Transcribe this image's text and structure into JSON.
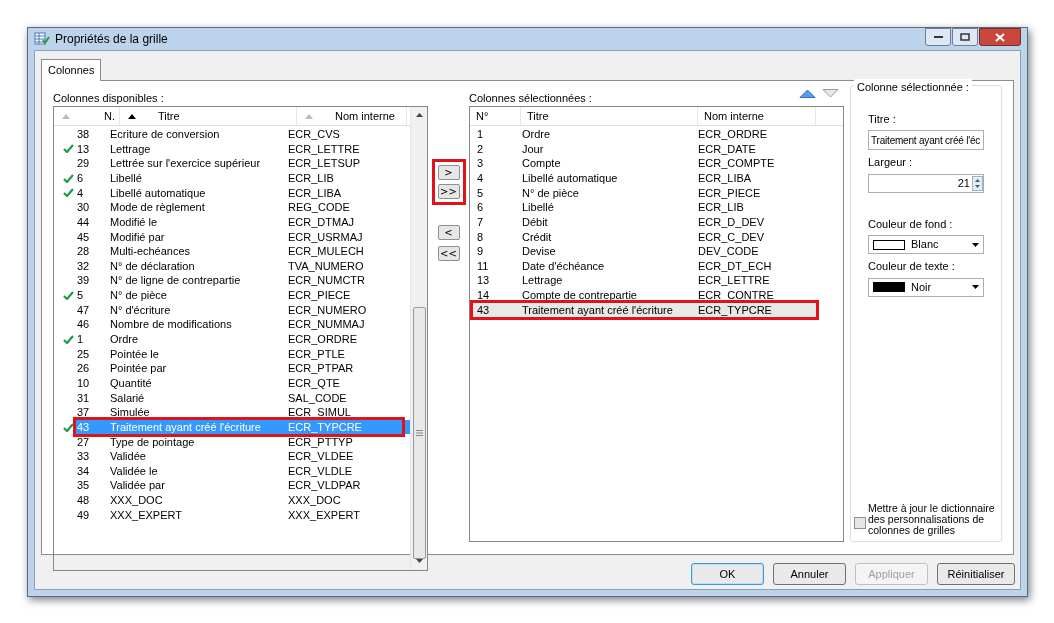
{
  "window": {
    "title": "Propriétés de la grille"
  },
  "tabs": [
    {
      "label": "Colonnes",
      "selected": true
    }
  ],
  "available": {
    "label": "Colonnes disponibles :",
    "columns": [
      {
        "label": "N.",
        "sorted": false
      },
      {
        "label": "Titre",
        "sorted": true
      },
      {
        "label": "Nom interne",
        "sorted": false
      }
    ],
    "rows": [
      {
        "checked": false,
        "number": "38",
        "title": "Ecriture de conversion",
        "internal": "ECR_CVS",
        "selected": false,
        "annotated": false
      },
      {
        "checked": true,
        "number": "13",
        "title": "Lettrage",
        "internal": "ECR_LETTRE",
        "selected": false,
        "annotated": false
      },
      {
        "checked": false,
        "number": "29",
        "title": "Lettrée sur l'exercice supérieur",
        "internal": "ECR_LETSUP",
        "selected": false,
        "annotated": false
      },
      {
        "checked": true,
        "number": "6",
        "title": "Libellé",
        "internal": "ECR_LIB",
        "selected": false,
        "annotated": false
      },
      {
        "checked": true,
        "number": "4",
        "title": "Libellé automatique",
        "internal": "ECR_LIBA",
        "selected": false,
        "annotated": false
      },
      {
        "checked": false,
        "number": "30",
        "title": "Mode de règlement",
        "internal": "REG_CODE",
        "selected": false,
        "annotated": false
      },
      {
        "checked": false,
        "number": "44",
        "title": "Modifié le",
        "internal": "ECR_DTMAJ",
        "selected": false,
        "annotated": false
      },
      {
        "checked": false,
        "number": "45",
        "title": "Modifié par",
        "internal": "ECR_USRMAJ",
        "selected": false,
        "annotated": false
      },
      {
        "checked": false,
        "number": "28",
        "title": "Multi-echéances",
        "internal": "ECR_MULECH",
        "selected": false,
        "annotated": false
      },
      {
        "checked": false,
        "number": "32",
        "title": "N° de déclaration",
        "internal": "TVA_NUMERO",
        "selected": false,
        "annotated": false
      },
      {
        "checked": false,
        "number": "39",
        "title": "N° de ligne de contrepartie",
        "internal": "ECR_NUMCTR",
        "selected": false,
        "annotated": false
      },
      {
        "checked": true,
        "number": "5",
        "title": "N° de pièce",
        "internal": "ECR_PIECE",
        "selected": false,
        "annotated": false
      },
      {
        "checked": false,
        "number": "47",
        "title": "N° d'écriture",
        "internal": "ECR_NUMERO",
        "selected": false,
        "annotated": false
      },
      {
        "checked": false,
        "number": "46",
        "title": "Nombre de modifications",
        "internal": "ECR_NUMMAJ",
        "selected": false,
        "annotated": false
      },
      {
        "checked": true,
        "number": "1",
        "title": "Ordre",
        "internal": "ECR_ORDRE",
        "selected": false,
        "annotated": false
      },
      {
        "checked": false,
        "number": "25",
        "title": "Pointée le",
        "internal": "ECR_PTLE",
        "selected": false,
        "annotated": false
      },
      {
        "checked": false,
        "number": "26",
        "title": "Pointée par",
        "internal": "ECR_PTPAR",
        "selected": false,
        "annotated": false
      },
      {
        "checked": false,
        "number": "10",
        "title": "Quantité",
        "internal": "ECR_QTE",
        "selected": false,
        "annotated": false
      },
      {
        "checked": false,
        "number": "31",
        "title": "Salarié",
        "internal": "SAL_CODE",
        "selected": false,
        "annotated": false
      },
      {
        "checked": false,
        "number": "37",
        "title": "Simulée",
        "internal": "ECR_SIMUL",
        "selected": false,
        "annotated": false
      },
      {
        "checked": true,
        "number": "43",
        "title": "Traitement ayant créé l'écriture",
        "internal": "ECR_TYPCRE",
        "selected": true,
        "annotated": true
      },
      {
        "checked": false,
        "number": "27",
        "title": "Type de pointage",
        "internal": "ECR_PTTYP",
        "selected": false,
        "annotated": false
      },
      {
        "checked": false,
        "number": "33",
        "title": "Validée",
        "internal": "ECR_VLDEE",
        "selected": false,
        "annotated": false
      },
      {
        "checked": false,
        "number": "34",
        "title": "Validée le",
        "internal": "ECR_VLDLE",
        "selected": false,
        "annotated": false
      },
      {
        "checked": false,
        "number": "35",
        "title": "Validée par",
        "internal": "ECR_VLDPAR",
        "selected": false,
        "annotated": false
      },
      {
        "checked": false,
        "number": "48",
        "title": "XXX_DOC",
        "internal": "XXX_DOC",
        "selected": false,
        "annotated": false
      },
      {
        "checked": false,
        "number": "49",
        "title": "XXX_EXPERT",
        "internal": "XXX_EXPERT",
        "selected": false,
        "annotated": false
      }
    ]
  },
  "add_buttons": {
    "annotated": true,
    "labels": [
      ">",
      ">>"
    ]
  },
  "remove_buttons": {
    "annotated": false,
    "labels": [
      "<",
      "<<"
    ]
  },
  "selected_columns": {
    "label": "Colonnes sélectionnées :",
    "columns": [
      "N°",
      "Titre",
      "Nom interne"
    ],
    "rows": [
      {
        "number": "1",
        "title": "Ordre",
        "internal": "ECR_ORDRE",
        "selected": false,
        "annotated": false
      },
      {
        "number": "2",
        "title": "Jour",
        "internal": "ECR_DATE",
        "selected": false,
        "annotated": false
      },
      {
        "number": "3",
        "title": "Compte",
        "internal": "ECR_COMPTE",
        "selected": false,
        "annotated": false
      },
      {
        "number": "4",
        "title": "Libellé automatique",
        "internal": "ECR_LIBA",
        "selected": false,
        "annotated": false
      },
      {
        "number": "5",
        "title": "N° de pièce",
        "internal": "ECR_PIECE",
        "selected": false,
        "annotated": false
      },
      {
        "number": "6",
        "title": "Libellé",
        "internal": "ECR_LIB",
        "selected": false,
        "annotated": false
      },
      {
        "number": "7",
        "title": "Débit",
        "internal": "ECR_D_DEV",
        "selected": false,
        "annotated": false
      },
      {
        "number": "8",
        "title": "Crédit",
        "internal": "ECR_C_DEV",
        "selected": false,
        "annotated": false
      },
      {
        "number": "9",
        "title": "Devise",
        "internal": "DEV_CODE",
        "selected": false,
        "annotated": false
      },
      {
        "number": "11",
        "title": "Date d'échéance",
        "internal": "ECR_DT_ECH",
        "selected": false,
        "annotated": false
      },
      {
        "number": "13",
        "title": "Lettrage",
        "internal": "ECR_LETTRE",
        "selected": false,
        "annotated": false
      },
      {
        "number": "14",
        "title": "Compte de contrepartie",
        "internal": "ECR_CONTRE",
        "selected": false,
        "annotated": false
      },
      {
        "number": "43",
        "title": "Traitement ayant créé l'écriture",
        "internal": "ECR_TYPCRE",
        "selected": true,
        "annotated": true
      }
    ]
  },
  "column_properties": {
    "label": "Colonne sélectionnée :",
    "title_label": "Titre :",
    "title_value": "Traitement ayant créé l'éc",
    "width_label": "Largeur :",
    "width_value": "21",
    "background_label": "Couleur de fond :",
    "background_value": "Blanc",
    "text_color_label": "Couleur de texte :",
    "text_color_value": "Noir",
    "update_dictionary": {
      "label": "Mettre à jour le dictionnaire des personnalisations de colonnes de grilles",
      "checked": false
    }
  },
  "buttons": [
    {
      "label": "OK",
      "kind": "default",
      "disabled": false
    },
    {
      "label": "Annuler",
      "kind": "normal",
      "disabled": false
    },
    {
      "label": "Appliquer",
      "kind": "normal",
      "disabled": true
    },
    {
      "label": "Réinitialiser",
      "kind": "normal",
      "disabled": false
    }
  ]
}
